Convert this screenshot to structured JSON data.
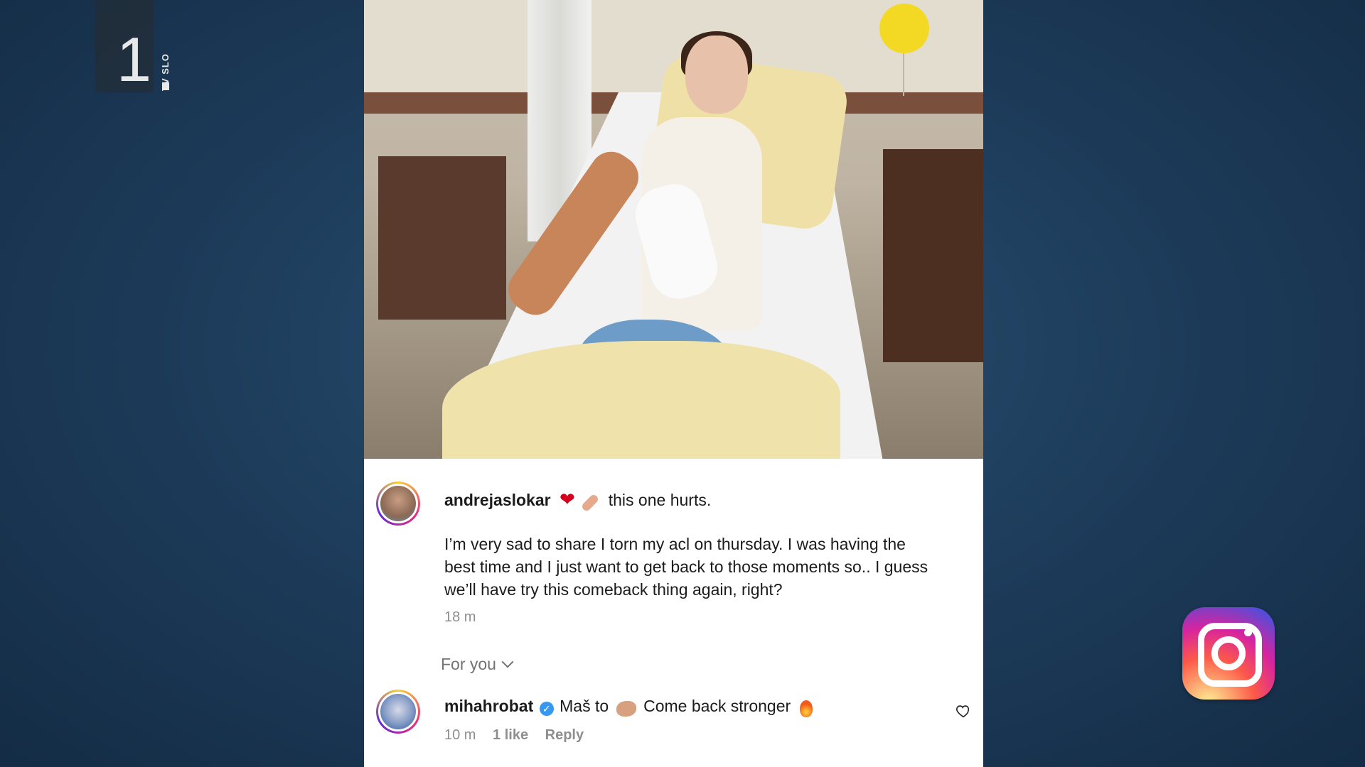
{
  "channel": {
    "number": "1",
    "name": "TV SLO"
  },
  "post": {
    "username": "andrejaslokar",
    "headline": "this one hurts.",
    "body_lines": [
      "I’m very sad to share I torn my acl on thursday. I was having the",
      "best time and I just want to get back to those moments so.. I guess",
      "we’ll have try this comeback thing again, right?"
    ],
    "time": "18 m"
  },
  "section_label": "For you",
  "comment": {
    "username": "mihahrobat",
    "text_before": "Maš to",
    "text_after": "Come back stronger",
    "time": "10 m",
    "likes": "1 like",
    "reply": "Reply"
  },
  "colors": {
    "background": "#1c3a58",
    "heart": "#d4001e",
    "verified": "#3897f0",
    "meta_text": "#8e8e8e"
  },
  "icons": [
    "heart-emoji",
    "bandage-emoji",
    "verified-icon",
    "muscle-emoji",
    "fire-emoji",
    "heart-outline-icon",
    "instagram-logo"
  ]
}
